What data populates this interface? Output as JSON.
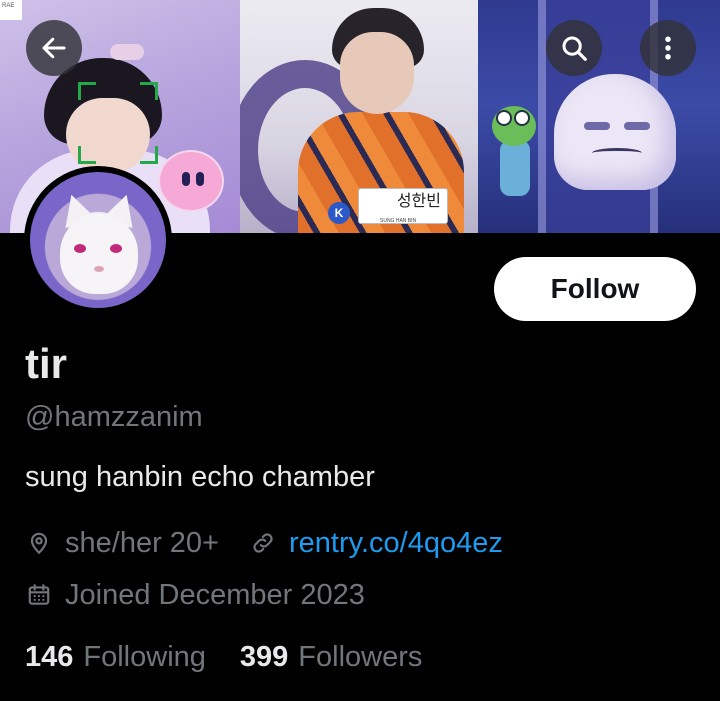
{
  "banner": {
    "badge_text": "RAE",
    "nametag_text": "성한빈",
    "nametag_sub": "SUNG HAN BIN",
    "team_letter": "K"
  },
  "nav": {
    "back_icon": "arrow-left-icon",
    "search_icon": "search-icon",
    "more_icon": "more-vertical-icon"
  },
  "profile": {
    "display_name": "tir",
    "handle": "@hamzzanim",
    "bio": "sung hanbin echo chamber",
    "location": "she/her 20+",
    "website": "rentry.co/4qo4ez",
    "joined": "Joined December 2023",
    "following_count": "146",
    "following_label": "Following",
    "followers_count": "399",
    "followers_label": "Followers"
  },
  "actions": {
    "follow_label": "Follow"
  },
  "colors": {
    "background": "#000000",
    "primary_text": "#e7e9ea",
    "secondary_text": "#71767b",
    "link": "#1d9bf0",
    "follow_button_bg": "#ffffff",
    "follow_button_text": "#0f1419"
  }
}
